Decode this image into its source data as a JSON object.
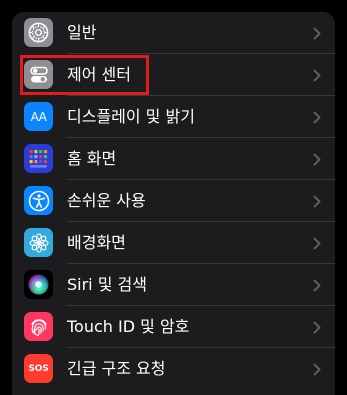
{
  "colors": {
    "background": "#000000",
    "group_background": "#1c1c1e",
    "separator": "#38383a",
    "label": "#ffffff",
    "chevron": "#5e5e62",
    "highlight_box": "#e31b1b"
  },
  "settings": {
    "items": [
      {
        "label": "일반",
        "icon": "gear-icon",
        "icon_color": "#8e8e93"
      },
      {
        "label": "제어 센터",
        "icon": "toggle-switches-icon",
        "icon_color": "#8e8e93",
        "highlighted": true
      },
      {
        "label": "디스플레이 및 밝기",
        "icon": "text-size-aa-icon",
        "icon_color": "#0a84ff",
        "icon_text": "AA"
      },
      {
        "label": "홈 화면",
        "icon": "home-screen-grid-icon",
        "icon_color": "#2c3cd6"
      },
      {
        "label": "손쉬운 사용",
        "icon": "accessibility-icon",
        "icon_color": "#0a84ff"
      },
      {
        "label": "배경화면",
        "icon": "wallpaper-flower-icon",
        "icon_color": "#34aadc"
      },
      {
        "label": "Siri 및 검색",
        "icon": "siri-orb-icon",
        "icon_color": "#000000"
      },
      {
        "label": "Touch ID 및 암호",
        "icon": "fingerprint-icon",
        "icon_color": "#ff375f"
      },
      {
        "label": "긴급 구조 요청",
        "icon": "sos-icon",
        "icon_color": "#ff3b30",
        "icon_text": "SOS"
      }
    ]
  }
}
